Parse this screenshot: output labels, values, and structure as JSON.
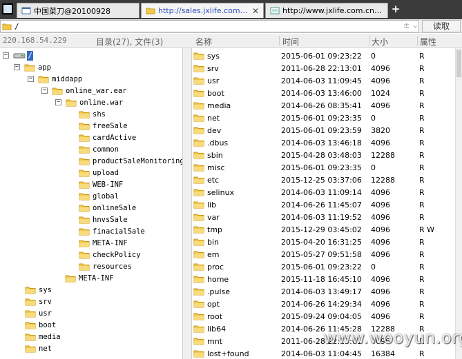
{
  "tabs": [
    {
      "label": "中国菜刀@20100928",
      "active": false
    },
    {
      "label": "http://sales.jxlife.com.cn/cssr...",
      "active": true
    },
    {
      "label": "http://www.jxlife.com.cn/cssr...",
      "active": false
    }
  ],
  "new_tab_glyph": "+",
  "address": {
    "path": "/",
    "nav_arrows": "± ⌄",
    "read_label": "读取"
  },
  "header": {
    "server": "220.168.54.229",
    "summary": "目录(27), 文件(3)",
    "columns": {
      "name": "名称",
      "time": "时间",
      "size": "大小",
      "attr": "属性"
    }
  },
  "tree": {
    "root_label": "/",
    "nodes": [
      {
        "label": "app"
      },
      {
        "label": "middapp"
      },
      {
        "label": "online_war.ear"
      },
      {
        "label": "online.war"
      },
      {
        "label": "shs"
      },
      {
        "label": "freeSale"
      },
      {
        "label": "cardActive"
      },
      {
        "label": "common"
      },
      {
        "label": "productSaleMonitoring"
      },
      {
        "label": "upload"
      },
      {
        "label": "WEB-INF"
      },
      {
        "label": "global"
      },
      {
        "label": "onlineSale"
      },
      {
        "label": "hnvsSale"
      },
      {
        "label": "finacialSale"
      },
      {
        "label": "META-INF"
      },
      {
        "label": "checkPolicy"
      },
      {
        "label": "resources"
      },
      {
        "label": "META-INF"
      },
      {
        "label": "sys"
      },
      {
        "label": "srv"
      },
      {
        "label": "usr"
      },
      {
        "label": "boot"
      },
      {
        "label": "media"
      },
      {
        "label": "net"
      }
    ]
  },
  "files": [
    {
      "name": "sys",
      "time": "2015-06-01 09:23:22",
      "size": "0",
      "attr": "R"
    },
    {
      "name": "srv",
      "time": "2011-06-28 22:13:01",
      "size": "4096",
      "attr": "R"
    },
    {
      "name": "usr",
      "time": "2014-06-03 11:09:45",
      "size": "4096",
      "attr": "R"
    },
    {
      "name": "boot",
      "time": "2014-06-03 13:46:00",
      "size": "1024",
      "attr": "R"
    },
    {
      "name": "media",
      "time": "2014-06-26 08:35:41",
      "size": "4096",
      "attr": "R"
    },
    {
      "name": "net",
      "time": "2015-06-01 09:23:35",
      "size": "0",
      "attr": "R"
    },
    {
      "name": "dev",
      "time": "2015-06-01 09:23:59",
      "size": "3820",
      "attr": "R"
    },
    {
      "name": ".dbus",
      "time": "2014-06-03 13:46:18",
      "size": "4096",
      "attr": "R"
    },
    {
      "name": "sbin",
      "time": "2015-04-28 03:48:03",
      "size": "12288",
      "attr": "R"
    },
    {
      "name": "misc",
      "time": "2015-06-01 09:23:35",
      "size": "0",
      "attr": "R"
    },
    {
      "name": "etc",
      "time": "2015-12-25 03:37:06",
      "size": "12288",
      "attr": "R"
    },
    {
      "name": "selinux",
      "time": "2014-06-03 11:09:14",
      "size": "4096",
      "attr": "R"
    },
    {
      "name": "lib",
      "time": "2014-06-26 11:45:07",
      "size": "4096",
      "attr": "R"
    },
    {
      "name": "var",
      "time": "2014-06-03 11:19:52",
      "size": "4096",
      "attr": "R"
    },
    {
      "name": "tmp",
      "time": "2015-12-29 03:45:02",
      "size": "4096",
      "attr": "R W"
    },
    {
      "name": "bin",
      "time": "2015-04-20 16:31:25",
      "size": "4096",
      "attr": "R"
    },
    {
      "name": "em",
      "time": "2015-05-27 09:51:58",
      "size": "4096",
      "attr": "R"
    },
    {
      "name": "proc",
      "time": "2015-06-01 09:23:22",
      "size": "0",
      "attr": "R"
    },
    {
      "name": "home",
      "time": "2015-11-18 16:45:10",
      "size": "4096",
      "attr": "R"
    },
    {
      "name": ".pulse",
      "time": "2014-06-03 13:49:17",
      "size": "4096",
      "attr": "R"
    },
    {
      "name": "opt",
      "time": "2014-06-26 14:29:34",
      "size": "4096",
      "attr": "R"
    },
    {
      "name": "root",
      "time": "2015-09-24 09:04:05",
      "size": "4096",
      "attr": "R"
    },
    {
      "name": "lib64",
      "time": "2014-06-26 11:45:28",
      "size": "12288",
      "attr": "R"
    },
    {
      "name": "mnt",
      "time": "2011-06-28 22:13:01",
      "size": "4096",
      "attr": "R"
    },
    {
      "name": "lost+found",
      "time": "2014-06-03 11:04:45",
      "size": "16384",
      "attr": "R"
    }
  ],
  "watermark": "www.wooyun.org",
  "colors": {
    "folder": "#f2c94c",
    "folder_dark": "#c99a1a",
    "selection": "#316ac5"
  }
}
